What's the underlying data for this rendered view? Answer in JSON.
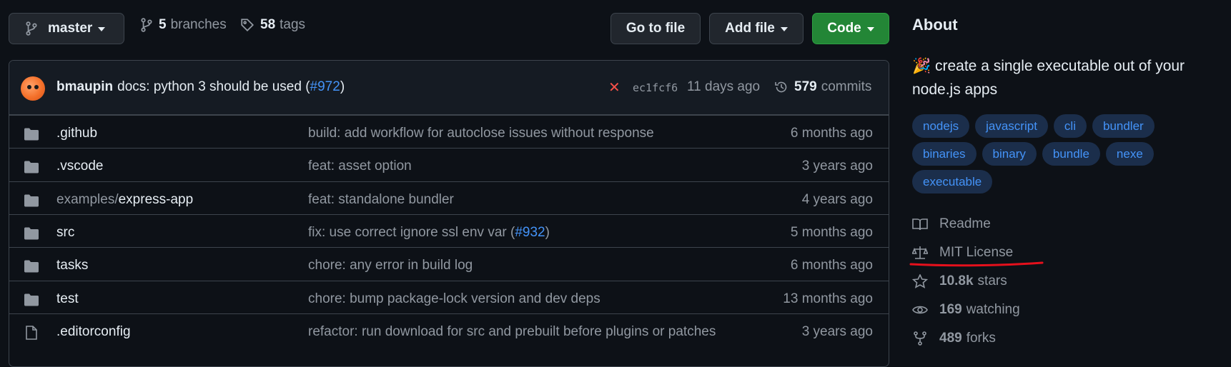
{
  "toolbar": {
    "branch": "master",
    "branches_count": "5",
    "branches_label": "branches",
    "tags_count": "58",
    "tags_label": "tags",
    "go_to_file": "Go to file",
    "add_file": "Add file",
    "code": "Code"
  },
  "commit": {
    "author": "bmaupin",
    "message_prefix": "docs: python 3 should be used (",
    "message_link": "#972",
    "message_suffix": ")",
    "status": "✕",
    "sha": "ec1fcf6",
    "time": "11 days ago",
    "commits_count": "579",
    "commits_label": "commits"
  },
  "files": [
    {
      "prefix": "",
      "name": ".github",
      "msg": "build: add workflow for autoclose issues without response",
      "msg_link": "",
      "msg_suffix": "",
      "age": "6 months ago",
      "icon": "folder-icon"
    },
    {
      "prefix": "",
      "name": ".vscode",
      "msg": "feat: asset option",
      "msg_link": "",
      "msg_suffix": "",
      "age": "3 years ago",
      "icon": "folder-icon"
    },
    {
      "prefix": "examples/",
      "name": "express-app",
      "msg": "feat: standalone bundler",
      "msg_link": "",
      "msg_suffix": "",
      "age": "4 years ago",
      "icon": "folder-icon"
    },
    {
      "prefix": "",
      "name": "src",
      "msg": "fix: use correct ignore ssl env var (",
      "msg_link": "#932",
      "msg_suffix": ")",
      "age": "5 months ago",
      "icon": "folder-icon"
    },
    {
      "prefix": "",
      "name": "tasks",
      "msg": "chore: any error in build log",
      "msg_link": "",
      "msg_suffix": "",
      "age": "6 months ago",
      "icon": "folder-icon"
    },
    {
      "prefix": "",
      "name": "test",
      "msg": "chore: bump package-lock version and dev deps",
      "msg_link": "",
      "msg_suffix": "",
      "age": "13 months ago",
      "icon": "folder-icon"
    },
    {
      "prefix": "",
      "name": ".editorconfig",
      "msg": "refactor: run download for src and prebuilt before plugins or patches",
      "msg_link": "",
      "msg_suffix": "",
      "age": "3 years ago",
      "icon": "file-icon"
    }
  ],
  "about": {
    "title": "About",
    "emoji": "🎉",
    "description": "create a single executable out of your node.js apps",
    "topics": [
      "nodejs",
      "javascript",
      "cli",
      "bundler",
      "binaries",
      "binary",
      "bundle",
      "nexe",
      "executable"
    ],
    "readme": "Readme",
    "license": "MIT License",
    "stars_count": "10.8k",
    "stars_label": "stars",
    "watching_count": "169",
    "watching_label": "watching",
    "forks_count": "489",
    "forks_label": "forks"
  },
  "colors": {
    "background": "#0d1117",
    "accent_link": "#4493f8",
    "code_button": "#238636",
    "annotation_underline": "#e5101c",
    "status_fail": "#f85149"
  }
}
